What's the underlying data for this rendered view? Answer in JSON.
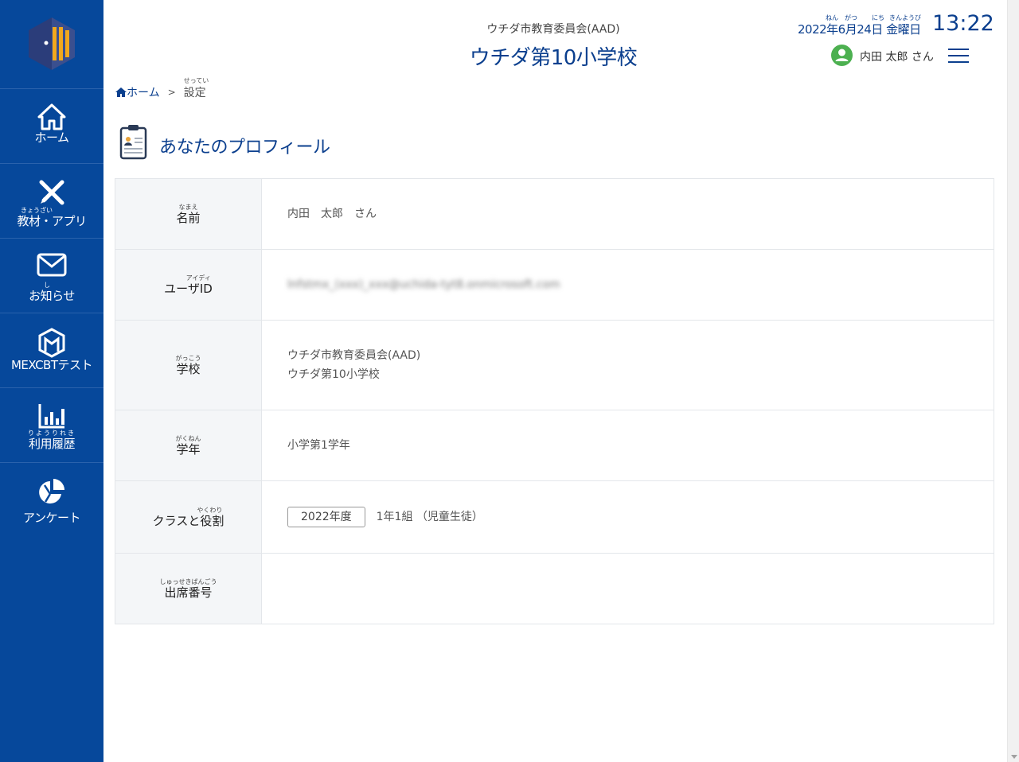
{
  "sidebar": {
    "items": [
      {
        "icon": "home-icon",
        "ruby": "",
        "label": "ホーム"
      },
      {
        "icon": "tools-icon",
        "ruby": "きょうざい",
        "label": "教材・アプリ"
      },
      {
        "icon": "mail-icon",
        "ruby": "し",
        "label": "お知らせ"
      },
      {
        "icon": "mexcbt-icon",
        "ruby": "",
        "label": "MEXCBTテスト"
      },
      {
        "icon": "chart-icon",
        "ruby": "りようりれき",
        "label": "利用履歴"
      },
      {
        "icon": "survey-icon",
        "ruby": "",
        "label": "アンケート"
      }
    ]
  },
  "header": {
    "org_name": "ウチダ市教育委員会(AAD)",
    "school_name": "ウチダ第10小学校",
    "date": "2022年6月24日 金曜日",
    "date_ruby": {
      "nen": "ねん",
      "gatsu": "がつ",
      "nichi": "にち",
      "youbi": "きんようび"
    },
    "time": "13:22",
    "user_name": "内田 太郎 さん"
  },
  "breadcrumb": {
    "home": "ホーム",
    "separator": ">",
    "current": "設定",
    "current_ruby": "せってい"
  },
  "page": {
    "title": "あなたのプロフィール"
  },
  "profile": {
    "name": {
      "ruby": "なまえ",
      "label": "名前",
      "value": "内田　太郎　さん"
    },
    "user_id": {
      "ruby": "アイディ",
      "label": "ユーザID",
      "value": "lnfstmx_(xxx)_xxx@uchida-tyt8.onmicrosoft.com"
    },
    "school": {
      "ruby": "がっこう",
      "label": "学校",
      "line1": "ウチダ市教育委員会(AAD)",
      "line2": "ウチダ第10小学校"
    },
    "grade": {
      "ruby": "がくねん",
      "label": "学年",
      "value": "小学第1学年"
    },
    "class_role": {
      "ruby": "やくわり",
      "label": "クラスと役割",
      "year": "2022年度",
      "value": "1年1組 （児童生徒）"
    },
    "attendance": {
      "ruby": "しゅっせきばんごう",
      "label": "出席番号",
      "value": ""
    }
  },
  "colors": {
    "sidebar": "#06489b",
    "accent": "#0b3f8e",
    "avatar": "#4cb050",
    "label_bg": "#f4f6f8"
  }
}
